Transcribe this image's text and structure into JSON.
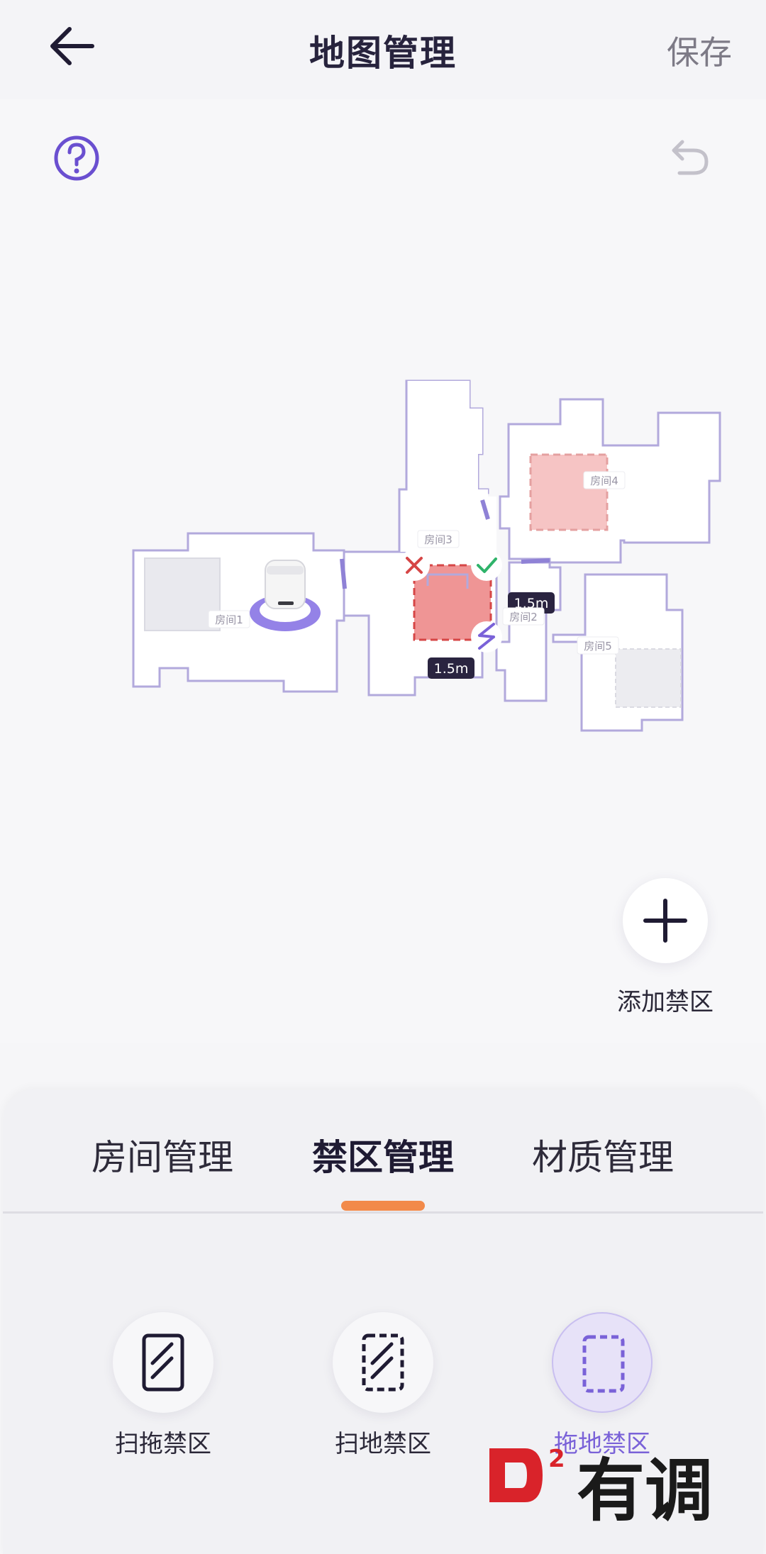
{
  "header": {
    "title": "地图管理",
    "save_label": "保存"
  },
  "map": {
    "rooms": [
      "房间1",
      "房间2",
      "房间3",
      "房间4",
      "房间5"
    ],
    "measure_width": "1.5m",
    "measure_height": "1.5m",
    "add_zone_label": "添加禁区"
  },
  "tabs": [
    {
      "label": "房间管理",
      "active": false
    },
    {
      "label": "禁区管理",
      "active": true
    },
    {
      "label": "材质管理",
      "active": false
    }
  ],
  "zone_types": [
    {
      "label": "扫拖禁区",
      "selected": false
    },
    {
      "label": "扫地禁区",
      "selected": false
    },
    {
      "label": "拖地禁区",
      "selected": true
    }
  ],
  "watermark": {
    "text": "有调"
  },
  "colors": {
    "accent": "#7a62d8",
    "tab_indicator": "#f28a4a",
    "wall": "#b2a9dc",
    "zone_red": "#e05555",
    "confirm_green": "#2fb36a"
  }
}
